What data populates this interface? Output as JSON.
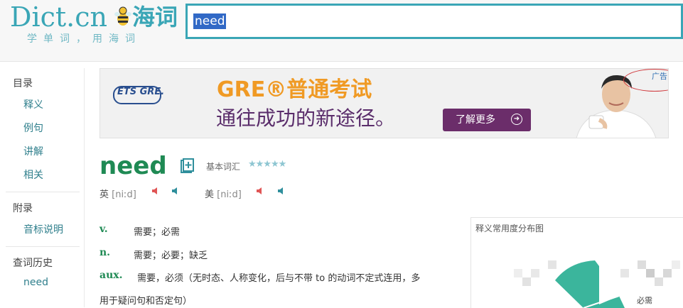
{
  "header": {
    "logo_main": "Dict.cn",
    "logo_cn": "海词",
    "logo_tagline": "学单词，用海词",
    "search_value": "need"
  },
  "sidebar": {
    "section1_title": "目录",
    "items": [
      "释义",
      "例句",
      "讲解",
      "相关"
    ],
    "section2_title": "附录",
    "appendix_items": [
      "音标说明"
    ],
    "section3_title": "查词历史",
    "history": [
      "need"
    ]
  },
  "ad": {
    "ets_logo": "ETS GRE.",
    "title": "GRE®普通考试",
    "subtitle": "通往成功的新途径。",
    "button_label": "了解更多",
    "label": "广告",
    "colors": {
      "title": "#f09a24",
      "subtitle": "#5a2d6b",
      "button": "#6b2d6a"
    }
  },
  "word": {
    "headword": "need",
    "level_label": "基本词汇",
    "stars": "★★★★★",
    "pron_uk_label": "英",
    "pron_uk": "[niːd]",
    "pron_us_label": "美",
    "pron_us": "[niːd]"
  },
  "definitions": [
    {
      "pos": "v.",
      "text": "需要；必需"
    },
    {
      "pos": "n.",
      "text": "需要；必要；缺乏"
    },
    {
      "pos": "aux.",
      "text": "需要，必须（无时态、人称变化，后与不带 to 的动词不定式连用，多",
      "continuation": "用于疑问句和否定句）"
    }
  ],
  "usage_panel": {
    "title": "释义常用度分布图",
    "pie_label": "必需",
    "colors": {
      "slice": "#3bb59c"
    }
  },
  "colors": {
    "accent": "#3aa6b6",
    "headword": "#1f8a54",
    "link": "#2f7f8c"
  }
}
